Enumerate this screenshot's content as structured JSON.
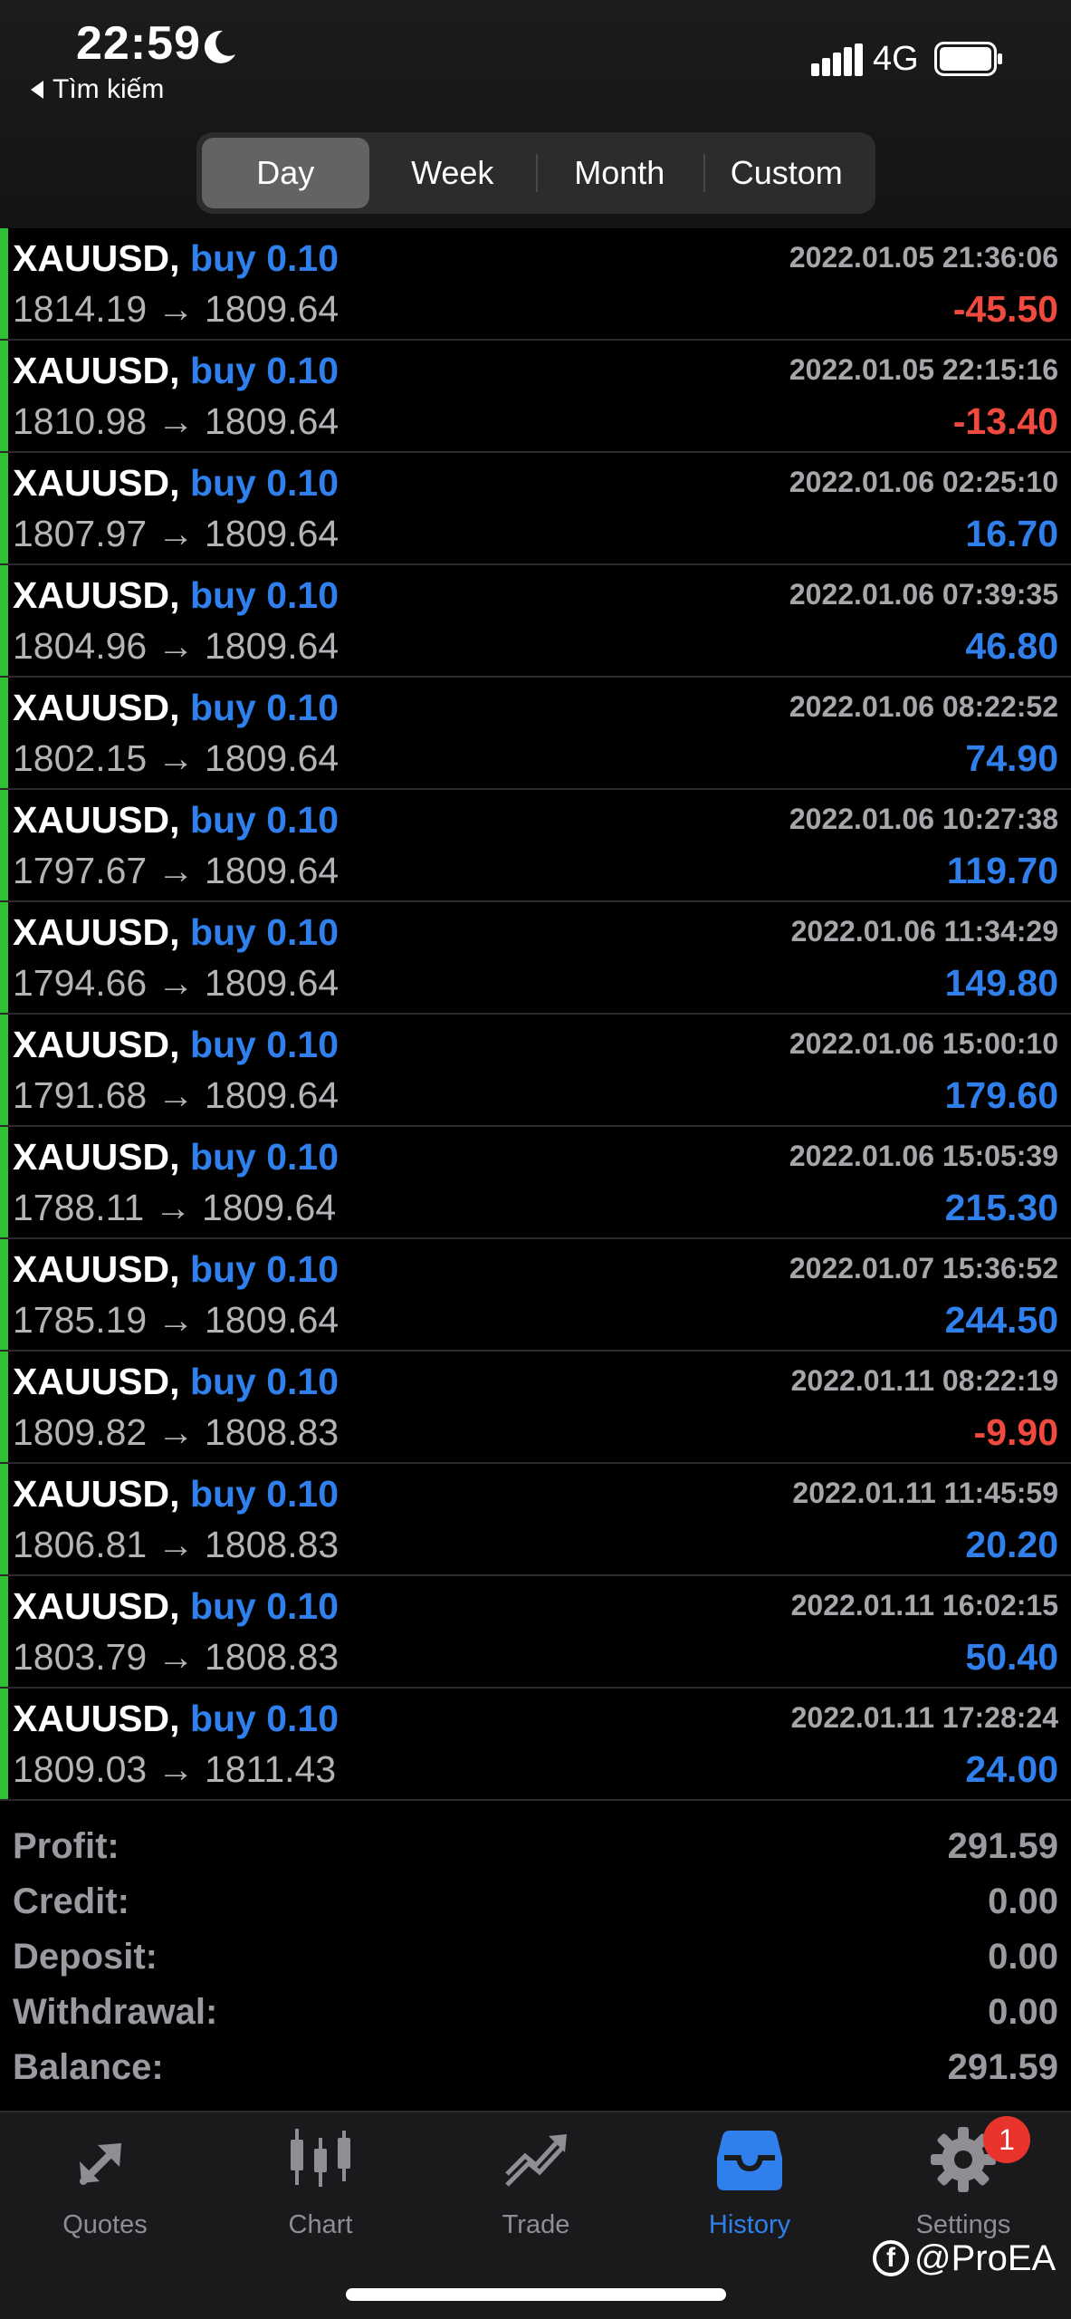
{
  "status_bar": {
    "time": "22:59",
    "network": "4G",
    "back_label": "Tìm kiếm"
  },
  "period_tabs": [
    {
      "label": "Day",
      "active": true
    },
    {
      "label": "Week",
      "active": false
    },
    {
      "label": "Month",
      "active": false
    },
    {
      "label": "Custom",
      "active": false
    }
  ],
  "trades": [
    {
      "symbol": "XAUUSD,",
      "type": "buy 0.10",
      "prices": "1814.19 → 1809.64",
      "datetime": "2022.01.05 21:36:06",
      "profit": "-45.50",
      "sign": "neg"
    },
    {
      "symbol": "XAUUSD,",
      "type": "buy 0.10",
      "prices": "1810.98 → 1809.64",
      "datetime": "2022.01.05 22:15:16",
      "profit": "-13.40",
      "sign": "neg"
    },
    {
      "symbol": "XAUUSD,",
      "type": "buy 0.10",
      "prices": "1807.97 → 1809.64",
      "datetime": "2022.01.06 02:25:10",
      "profit": "16.70",
      "sign": "pos"
    },
    {
      "symbol": "XAUUSD,",
      "type": "buy 0.10",
      "prices": "1804.96 → 1809.64",
      "datetime": "2022.01.06 07:39:35",
      "profit": "46.80",
      "sign": "pos"
    },
    {
      "symbol": "XAUUSD,",
      "type": "buy 0.10",
      "prices": "1802.15 → 1809.64",
      "datetime": "2022.01.06 08:22:52",
      "profit": "74.90",
      "sign": "pos"
    },
    {
      "symbol": "XAUUSD,",
      "type": "buy 0.10",
      "prices": "1797.67 → 1809.64",
      "datetime": "2022.01.06 10:27:38",
      "profit": "119.70",
      "sign": "pos"
    },
    {
      "symbol": "XAUUSD,",
      "type": "buy 0.10",
      "prices": "1794.66 → 1809.64",
      "datetime": "2022.01.06 11:34:29",
      "profit": "149.80",
      "sign": "pos"
    },
    {
      "symbol": "XAUUSD,",
      "type": "buy 0.10",
      "prices": "1791.68 → 1809.64",
      "datetime": "2022.01.06 15:00:10",
      "profit": "179.60",
      "sign": "pos"
    },
    {
      "symbol": "XAUUSD,",
      "type": "buy 0.10",
      "prices": "1788.11 → 1809.64",
      "datetime": "2022.01.06 15:05:39",
      "profit": "215.30",
      "sign": "pos"
    },
    {
      "symbol": "XAUUSD,",
      "type": "buy 0.10",
      "prices": "1785.19 → 1809.64",
      "datetime": "2022.01.07 15:36:52",
      "profit": "244.50",
      "sign": "pos"
    },
    {
      "symbol": "XAUUSD,",
      "type": "buy 0.10",
      "prices": "1809.82 → 1808.83",
      "datetime": "2022.01.11 08:22:19",
      "profit": "-9.90",
      "sign": "neg"
    },
    {
      "symbol": "XAUUSD,",
      "type": "buy 0.10",
      "prices": "1806.81 → 1808.83",
      "datetime": "2022.01.11 11:45:59",
      "profit": "20.20",
      "sign": "pos"
    },
    {
      "symbol": "XAUUSD,",
      "type": "buy 0.10",
      "prices": "1803.79 → 1808.83",
      "datetime": "2022.01.11 16:02:15",
      "profit": "50.40",
      "sign": "pos"
    },
    {
      "symbol": "XAUUSD,",
      "type": "buy 0.10",
      "prices": "1809.03 → 1811.43",
      "datetime": "2022.01.11 17:28:24",
      "profit": "24.00",
      "sign": "pos"
    }
  ],
  "summary": [
    {
      "label": "Profit:",
      "value": "291.59"
    },
    {
      "label": "Credit:",
      "value": "0.00"
    },
    {
      "label": "Deposit:",
      "value": "0.00"
    },
    {
      "label": "Withdrawal:",
      "value": "0.00"
    },
    {
      "label": "Balance:",
      "value": "291.59"
    }
  ],
  "tab_bar": {
    "items": [
      {
        "label": "Quotes",
        "icon": "quotes-icon",
        "active": false
      },
      {
        "label": "Chart",
        "icon": "chart-icon",
        "active": false
      },
      {
        "label": "Trade",
        "icon": "trade-icon",
        "active": false
      },
      {
        "label": "History",
        "icon": "history-icon",
        "active": true
      },
      {
        "label": "Settings",
        "icon": "settings-icon",
        "active": false
      }
    ],
    "settings_badge": "1"
  },
  "watermark": "@ProEA",
  "colors": {
    "accent_blue": "#2f80ed",
    "loss_red": "#f0493e",
    "row_marker_green": "#2ec234",
    "badge_red": "#e8342d"
  }
}
